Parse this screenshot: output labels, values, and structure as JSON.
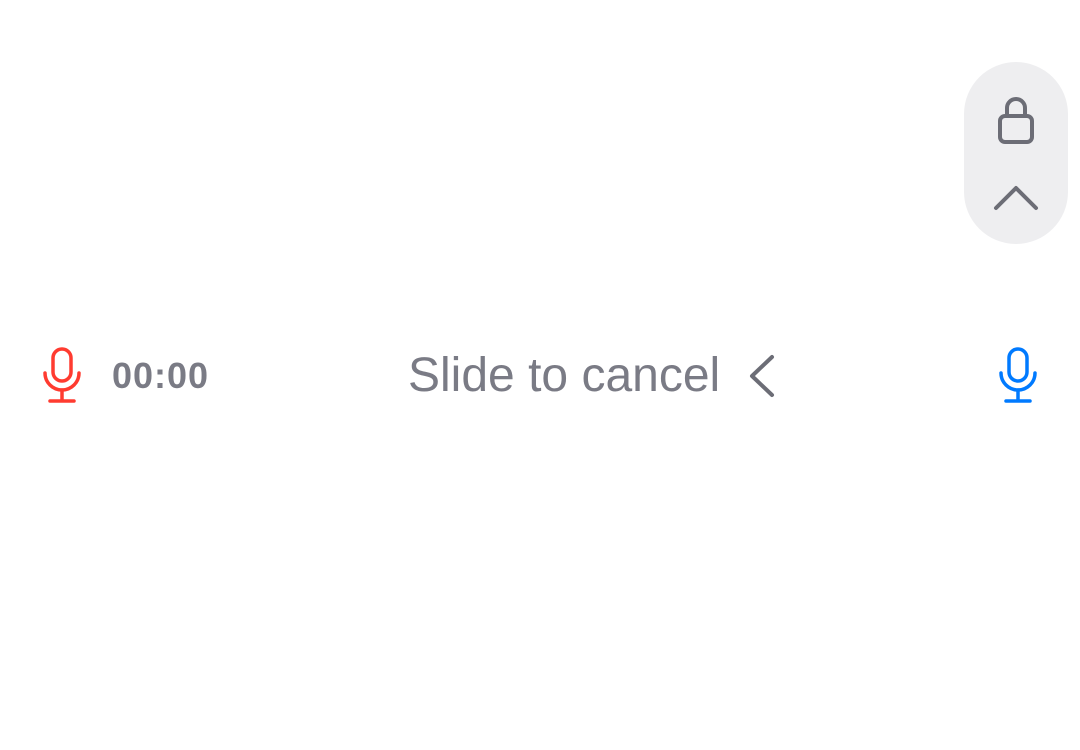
{
  "lock_control": {
    "lock_icon": "lock-icon",
    "chevron_icon": "chevron-up-icon"
  },
  "recording_bar": {
    "recording_icon": "microphone-icon",
    "timer": "00:00",
    "slide_label": "Slide to cancel",
    "slide_chevron_icon": "chevron-left-icon",
    "send_icon": "microphone-icon"
  },
  "colors": {
    "recording": "#ff3b30",
    "accent": "#007aff",
    "text_secondary": "#7a7b85",
    "pill_background": "#eeeef0",
    "icon_gray": "#6c6d76"
  }
}
